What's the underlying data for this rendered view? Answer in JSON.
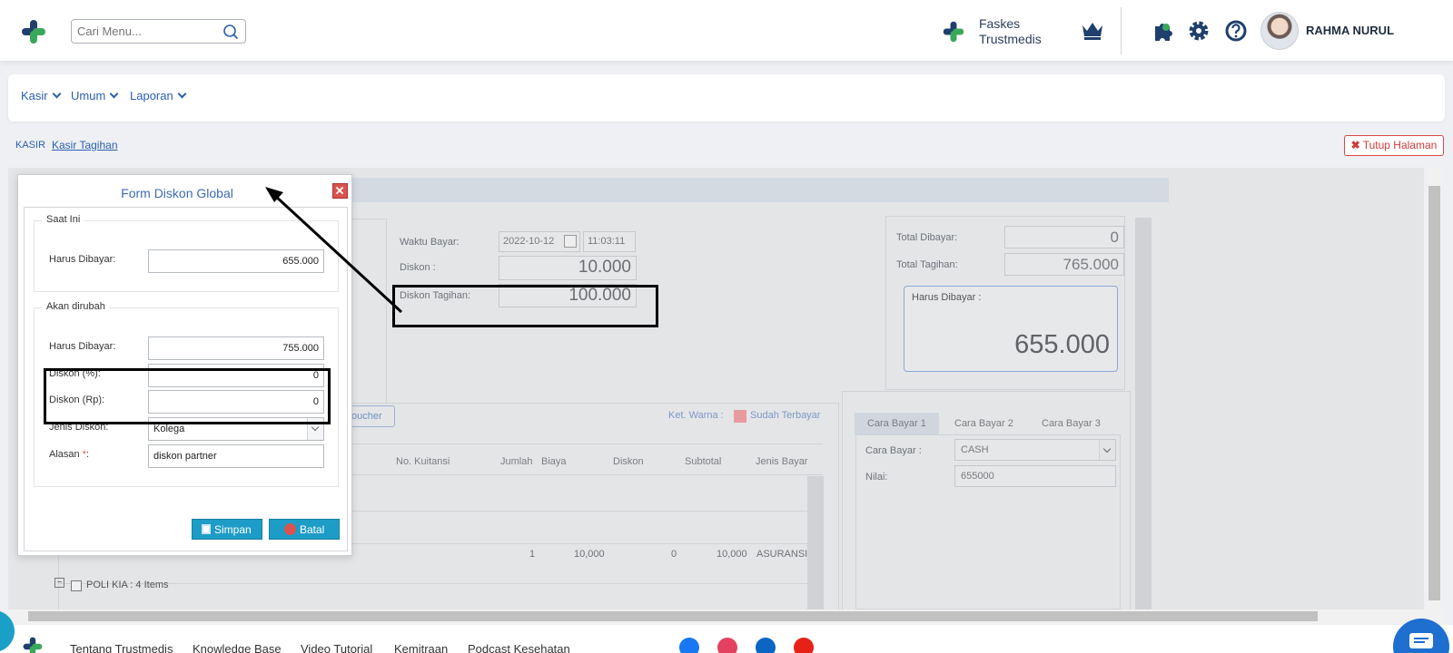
{
  "header": {
    "search_placeholder": "Cari Menu...",
    "faskes_line1": "Faskes",
    "faskes_line2": "Trustmedis",
    "user_name": "RAHMA NURUL"
  },
  "menubar": {
    "items": [
      {
        "label": "Kasir"
      },
      {
        "label": "Umum"
      },
      {
        "label": "Laporan"
      }
    ]
  },
  "breadcrumb": {
    "root": "KASIR",
    "current": "Kasir Tagihan",
    "close_label": "Tutup Halaman"
  },
  "payment": {
    "waktu_bayar_label": "Waktu Bayar:",
    "date": "2022-10-12",
    "time": "11:03:11",
    "diskon_label": "Diskon :",
    "diskon_value": "10.000",
    "diskon_tagihan_label": "Diskon Tagihan:",
    "diskon_tagihan_value": "100.000"
  },
  "totals": {
    "total_dibayar_label": "Total Dibayar:",
    "total_dibayar_value": "0",
    "total_tagihan_label": "Total Tagihan:",
    "total_tagihan_value": "765.000",
    "harus_dibayar_label": "Harus Dibayar :",
    "harus_dibayar_value": "655.000"
  },
  "items_panel": {
    "voucher_label": "oucher",
    "ket_warna": "Ket. Warna :",
    "sudah_terbayar": "Sudah Terbayar",
    "sudah_terbayar_color": "#e99aa0",
    "columns": [
      "No. Kuitansi",
      "Jumlah",
      "Biaya",
      "Diskon",
      "Subtotal",
      "Jenis Bayar"
    ],
    "row": {
      "jumlah": "1",
      "biaya": "10,000",
      "diskon": "0",
      "subtotal": "10,000",
      "jenis": "ASURANSI"
    },
    "group_label": "POLI KIA : 4 Items"
  },
  "cara_bayar": {
    "tabs": [
      "Cara Bayar 1",
      "Cara Bayar 2",
      "Cara Bayar 3"
    ],
    "cara_label": "Cara Bayar :",
    "cara_value": "CASH",
    "nilai_label": "Nilai:",
    "nilai_value": "655000"
  },
  "modal": {
    "title": "Form Diskon Global",
    "section_current": "Saat Ini",
    "current_harus_label": "Harus Dibayar:",
    "current_harus_value": "655.000",
    "section_change": "Akan dirubah",
    "change_harus_label": "Harus Dibayar:",
    "change_harus_value": "755.000",
    "diskon_pct_label": "Diskon (%):",
    "diskon_pct_value": "0",
    "diskon_rp_label": "Diskon (Rp):",
    "diskon_rp_value": "0",
    "jenis_label": "Jenis Diskon:",
    "jenis_value": "Kolega",
    "alasan_label": "Alasan",
    "alasan_required": "*",
    "alasan_colon": ":",
    "alasan_value": "diskon partner",
    "save_label": "Simpan",
    "cancel_label": "Batal"
  },
  "footer": {
    "links": [
      "Tentang Trustmedis",
      "Knowledge Base",
      "Video Tutorial",
      "Kemitraan",
      "Podcast Kesehatan"
    ]
  },
  "colors": {
    "brand_blue": "#2a5fb0",
    "brand_green": "#3aa85a",
    "brand_navy": "#1f3f6d",
    "button_blue": "#1e9cc8",
    "danger_red": "#d9534f"
  }
}
